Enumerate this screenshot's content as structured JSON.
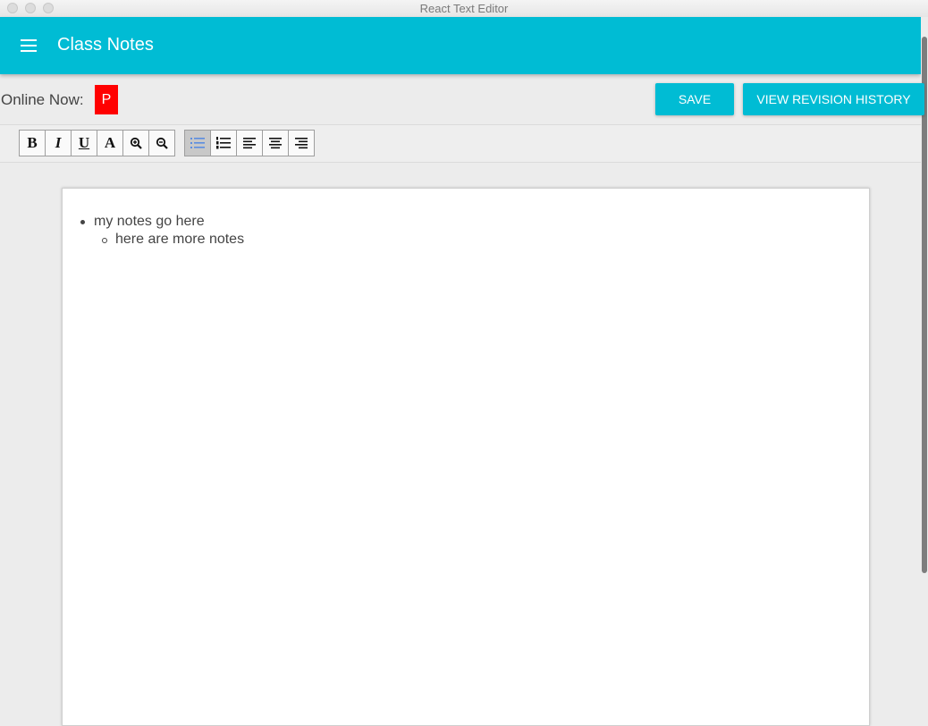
{
  "window": {
    "title": "React Text Editor"
  },
  "appbar": {
    "title": "Class Notes",
    "menu_icon": "hamburger-menu-icon",
    "color": "#00bcd4"
  },
  "presence": {
    "label": "Online Now:",
    "users": [
      {
        "initial": "P",
        "color": "#ff0000"
      }
    ]
  },
  "actions": {
    "save_label": "SAVE",
    "history_label": "VIEW REVISION HISTORY"
  },
  "toolbar": {
    "style_buttons": [
      {
        "name": "bold",
        "glyph": "B"
      },
      {
        "name": "italic",
        "glyph": "I"
      },
      {
        "name": "underline",
        "glyph": "U"
      },
      {
        "name": "font-color",
        "glyph": "A"
      },
      {
        "name": "zoom-in",
        "icon": "zoom-in-icon"
      },
      {
        "name": "zoom-out",
        "icon": "zoom-out-icon"
      }
    ],
    "block_buttons": [
      {
        "name": "unordered-list",
        "icon": "bullet-list-icon",
        "active": true
      },
      {
        "name": "ordered-list",
        "icon": "numbered-list-icon",
        "active": false
      },
      {
        "name": "align-left",
        "icon": "align-left-icon",
        "active": false
      },
      {
        "name": "align-center",
        "icon": "align-center-icon",
        "active": false
      },
      {
        "name": "align-right",
        "icon": "align-right-icon",
        "active": false
      }
    ]
  },
  "document": {
    "items": [
      {
        "level": 1,
        "text": "my notes go here"
      },
      {
        "level": 2,
        "text": "here are more notes"
      }
    ]
  }
}
